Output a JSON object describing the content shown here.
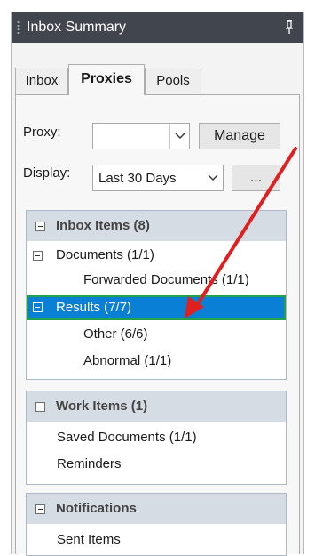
{
  "panel": {
    "title": "Inbox Summary",
    "pin_icon": "pin-icon"
  },
  "tabs": [
    {
      "label": "Inbox",
      "active": false
    },
    {
      "label": "Proxies",
      "active": true
    },
    {
      "label": "Pools",
      "active": false
    }
  ],
  "proxy": {
    "label": "Proxy:",
    "value": "",
    "manage_label": "Manage"
  },
  "display": {
    "label": "Display:",
    "value": "Last 30 Days",
    "more_label": "..."
  },
  "groups": {
    "inbox_items": {
      "title": "Inbox Items (8)",
      "documents": "Documents (1/1)",
      "forwarded_documents": "Forwarded Documents (1/1)",
      "results": "Results (7/7)",
      "other": "Other (6/6)",
      "abnormal": "Abnormal (1/1)"
    },
    "work_items": {
      "title": "Work Items (1)",
      "saved_documents": "Saved Documents (1/1)",
      "reminders": "Reminders"
    },
    "notifications": {
      "title": "Notifications",
      "sent_items": "Sent Items"
    }
  },
  "colors": {
    "titlebar": "#41454d",
    "selection": "#0a7fd6",
    "selection_outline": "#23a04a",
    "group_header": "#d6dce4",
    "annotation_arrow": "#e02020"
  }
}
